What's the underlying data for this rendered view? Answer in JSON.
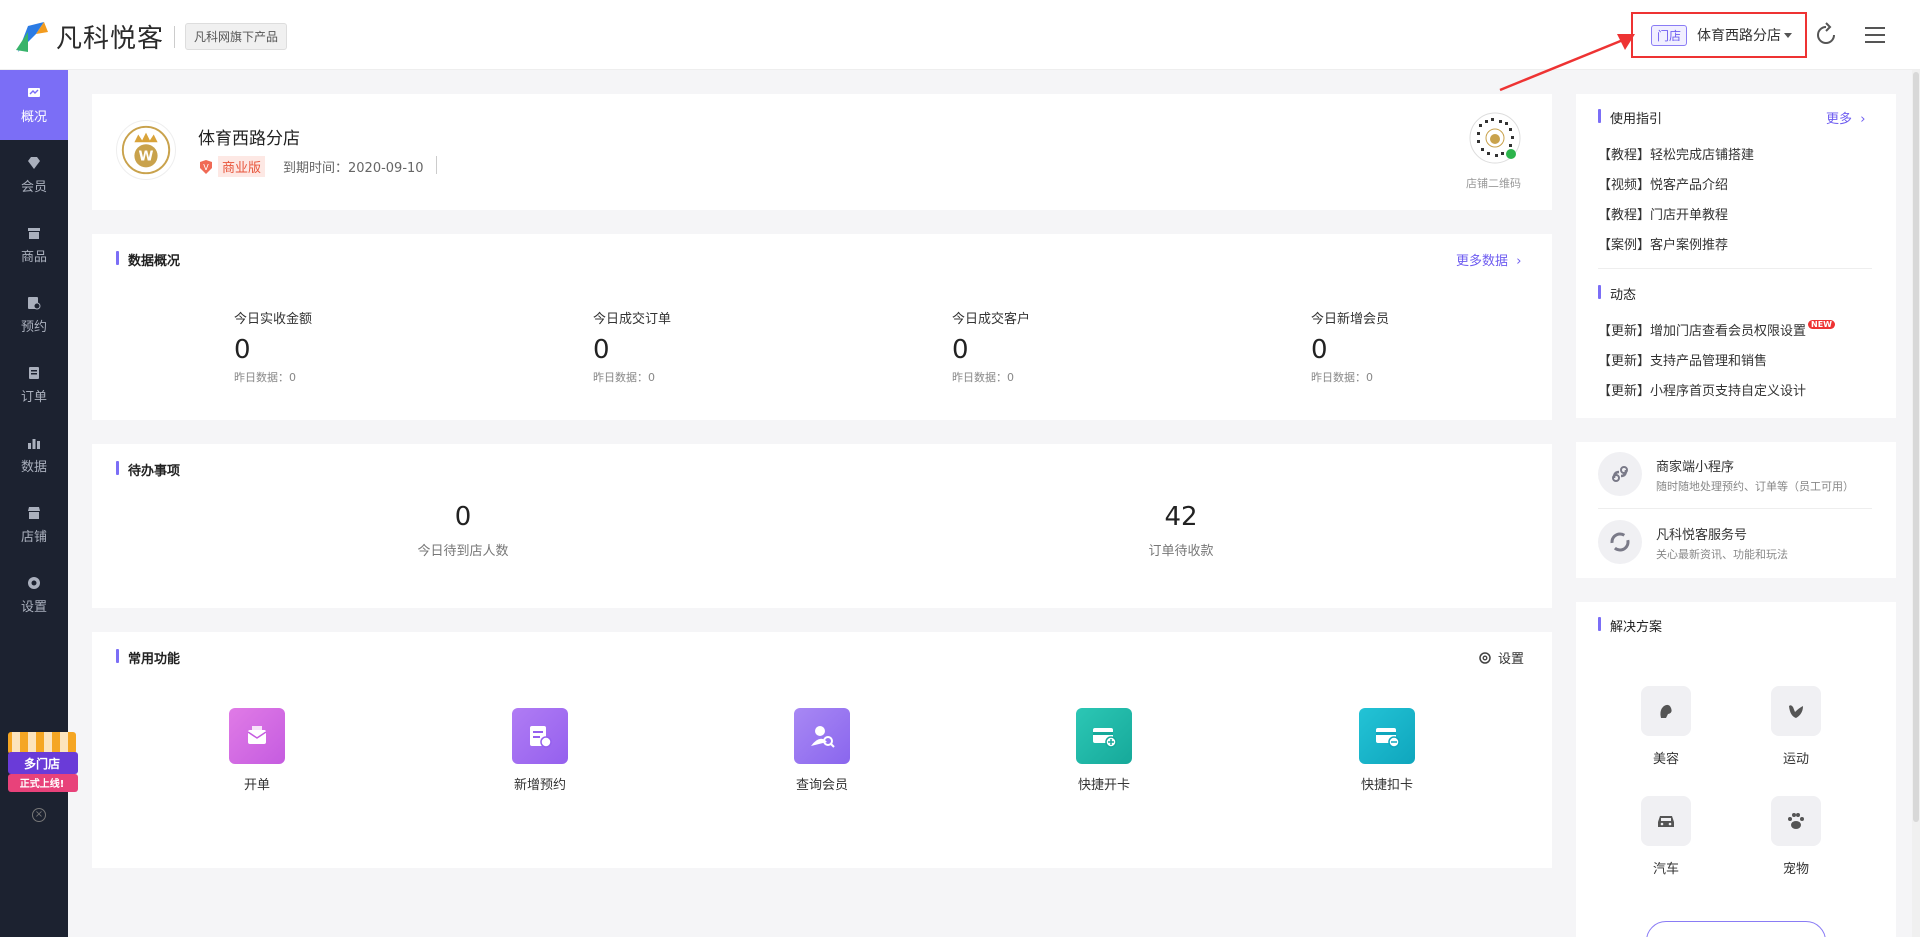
{
  "header": {
    "logo_text": "凡科悦客",
    "logo_sub": "凡科网旗下产品",
    "store_tag": "门店",
    "store_name": "体育西路分店"
  },
  "sidebar": {
    "items": [
      {
        "label": "概况",
        "icon": "overview-icon"
      },
      {
        "label": "会员",
        "icon": "diamond-icon"
      },
      {
        "label": "商品",
        "icon": "goods-icon"
      },
      {
        "label": "预约",
        "icon": "booking-icon"
      },
      {
        "label": "订单",
        "icon": "order-icon"
      },
      {
        "label": "数据",
        "icon": "chart-icon"
      },
      {
        "label": "店铺",
        "icon": "shop-icon"
      },
      {
        "label": "设置",
        "icon": "gear-icon"
      }
    ],
    "promo": {
      "line1": "多门店",
      "line2": "正式上线!"
    }
  },
  "store_card": {
    "name": "体育西路分店",
    "edition": "商业版",
    "expire": "到期时间：2020-09-10",
    "qr_label": "店铺二维码"
  },
  "overview": {
    "title": "数据概况",
    "more": "更多数据",
    "stats": [
      {
        "label": "今日实收金额",
        "value": "0",
        "sub": "昨日数据：0"
      },
      {
        "label": "今日成交订单",
        "value": "0",
        "sub": "昨日数据：0"
      },
      {
        "label": "今日成交客户",
        "value": "0",
        "sub": "昨日数据：0"
      },
      {
        "label": "今日新增会员",
        "value": "0",
        "sub": "昨日数据：0"
      }
    ]
  },
  "todo": {
    "title": "待办事项",
    "items": [
      {
        "value": "0",
        "label": "今日待到店人数"
      },
      {
        "value": "42",
        "label": "订单待收款"
      }
    ]
  },
  "functions": {
    "title": "常用功能",
    "settings": "设置",
    "items": [
      {
        "label": "开单",
        "color": "#d36ce0"
      },
      {
        "label": "新增预约",
        "color": "#a06cf0"
      },
      {
        "label": "查询会员",
        "color": "#9a6cf0"
      },
      {
        "label": "快捷开卡",
        "color": "#21b8a8"
      },
      {
        "label": "快捷扣卡",
        "color": "#1ab4c6"
      }
    ]
  },
  "guide": {
    "title": "使用指引",
    "more": "更多",
    "items": [
      "【教程】轻松完成店铺搭建",
      "【视频】悦客产品介绍",
      "【教程】门店开单教程",
      "【案例】客户案例推荐"
    ]
  },
  "news": {
    "title": "动态",
    "items": [
      "【更新】增加门店查看会员权限设置",
      "【更新】支持产品管理和销售",
      "【更新】小程序首页支持自定义设计"
    ],
    "new_badge": "NEW"
  },
  "services": [
    {
      "title": "商家端小程序",
      "desc": "随时随地处理预约、订单等（员工可用）"
    },
    {
      "title": "凡科悦客服务号",
      "desc": "关心最新资讯、功能和玩法"
    }
  ],
  "solutions": {
    "title": "解决方案",
    "items": [
      {
        "label": "美容",
        "icon": "beauty-icon"
      },
      {
        "label": "运动",
        "icon": "sport-icon"
      },
      {
        "label": "汽车",
        "icon": "car-icon"
      },
      {
        "label": "宠物",
        "icon": "pet-icon"
      }
    ]
  },
  "colors": {
    "accent": "#7b6ef6",
    "sidebar": "#1c2230",
    "highlight": "#e33333"
  }
}
